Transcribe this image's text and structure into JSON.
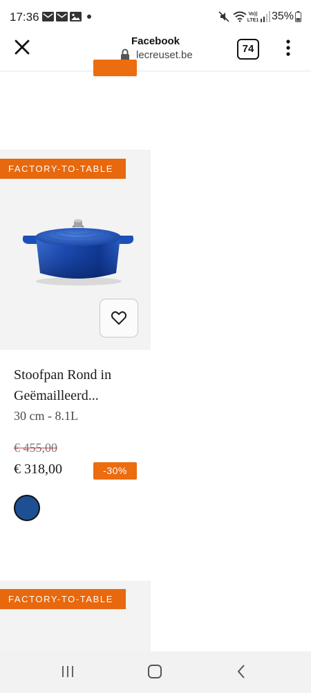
{
  "status_bar": {
    "time": "17:36",
    "battery": "35%",
    "icons": [
      "mail-icon",
      "mail-icon",
      "image-icon",
      "dot",
      "mute-icon",
      "wifi-icon",
      "volte-icon",
      "signal-icon",
      "battery-icon"
    ]
  },
  "browser": {
    "title": "Facebook",
    "url": "lecreuset.be",
    "tab_count": "74",
    "icons": [
      "close-icon",
      "lock-icon",
      "more-icon"
    ]
  },
  "product": {
    "badge": "FACTORY-TO-TABLE",
    "name": "Stoofpan Rond in Geëmailleerd...",
    "size": "30 cm - 8.1L",
    "old_price": "€ 455,00",
    "new_price": "€ 318,00",
    "discount": "-30%",
    "swatch_color": "#1d4f93"
  },
  "next_product": {
    "badge": "FACTORY-TO-TABLE"
  },
  "colors": {
    "accent": "#ec6c10",
    "image_bg": "#f3f3f3"
  },
  "nav_bar": {
    "icons": [
      "recent-apps-icon",
      "home-icon",
      "back-icon"
    ]
  }
}
